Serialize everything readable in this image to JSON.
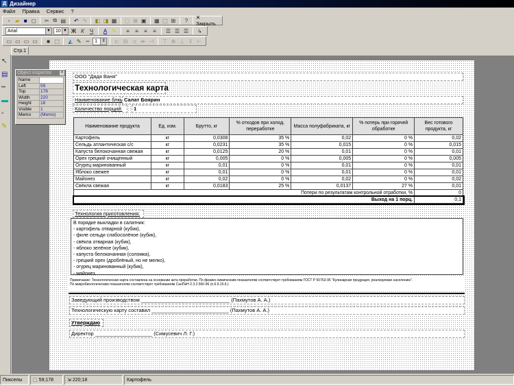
{
  "window": {
    "title": "Дизайнер"
  },
  "menu": [
    "Файл",
    "Правка",
    "Сервис",
    "?"
  ],
  "toolbar": {
    "close_label": "Закрыть",
    "font": "Arial",
    "size": "10",
    "bold": "Ж",
    "italic": "К",
    "underline": "Ч",
    "line_width": "1"
  },
  "tabs": [
    "Стр.1"
  ],
  "inspector": {
    "title": "Object inspector",
    "props": [
      [
        "Name",
        ""
      ],
      [
        "Left",
        "59"
      ],
      [
        "Top",
        "178"
      ],
      [
        "Width",
        "220"
      ],
      [
        "Height",
        "18"
      ],
      [
        "Visible",
        "1"
      ],
      [
        "Memo",
        "(Memo)"
      ]
    ]
  },
  "doc": {
    "company": "ООО \"Дядя Ваня\"",
    "title": "Технологическая карта",
    "dish_label": "Наименование блюда:",
    "dish": "Салат Боярин",
    "portions_label": "Количество порций:",
    "portions": "1",
    "headers": [
      "Наименование продукта",
      "Ед. изм.",
      "Брутто, кг",
      "% отходов при холод. переработке",
      "Масса полуфабриката, кг",
      "% потерь при горячей обработке",
      "Вес готового продукта, кг"
    ],
    "rows": [
      [
        "Картофель",
        "кг",
        "0,0308",
        "35 %",
        "0,02",
        "0 %",
        "0,02"
      ],
      [
        "Сельдь атлантическая с/с",
        "кг",
        "0,0231",
        "35 %",
        "0,015",
        "0 %",
        "0,015"
      ],
      [
        "Капуста белокочанная свежая",
        "кг",
        "0,0125",
        "20 %",
        "0,01",
        "0 %",
        "0,01"
      ],
      [
        "Орех грецкий очищенный",
        "кг",
        "0,005",
        "0 %",
        "0,005",
        "0 %",
        "0,005"
      ],
      [
        "Огурец маринованный",
        "кг",
        "0,01",
        "0 %",
        "0,01",
        "0 %",
        "0,01"
      ],
      [
        "Яблоко свежее",
        "кг",
        "0,01",
        "0 %",
        "0,01",
        "0 %",
        "0,01"
      ],
      [
        "Майонез",
        "кг",
        "0,02",
        "0 %",
        "0,02",
        "0 %",
        "0,02"
      ],
      [
        "Свёкла свежая",
        "кг",
        "0,0183",
        "25 %",
        "0,0137",
        "27 %",
        "0,01"
      ]
    ],
    "loss_label": "Потери по результатам контрольной отработки, %",
    "loss": "0",
    "yield_label": "Выход на 1 порц.",
    "yield": "0,1",
    "tech_label": "Технология приготовления:",
    "recipe": [
      "В порядке выкладки в салатник:",
      "- картофель отварной (кубик),",
      "- филе сельди слабосолёное (кубик),",
      "- свёкла отварная (кубик),",
      "- яблоко зелёное (кубик),",
      "- капуста белокачанная (соломка),",
      "- грецкий орех (дроблёный, но не мелко),",
      "- огурец маринованный (кубик),",
      "- майонез."
    ],
    "note1": "Примечание: Технологическая карта составлена на основании акта проработки. По физико-химическим показателям соответствует требованиям ГОСТ Р 50763-95 \"Кулинарная продукция, реализуемая населению\".",
    "note2": "По микробиологическим показателям соответствует требованиям СанПиН 2.3.2.560-96 (п.6.9.15.6.)",
    "sign1": "Заведующий производством _______________________________ (Пахмутов А. А.)",
    "sign2": "Технологическую карту составил ___________________________ (Пахмутов А. А.)",
    "approve": "Утверждаю",
    "sign3": "Директор ____________________ (Симусевич Л. Г.)"
  },
  "status": {
    "units": "Пикселы",
    "pos": "59;178",
    "size": "220;18",
    "object": "Картофель"
  }
}
